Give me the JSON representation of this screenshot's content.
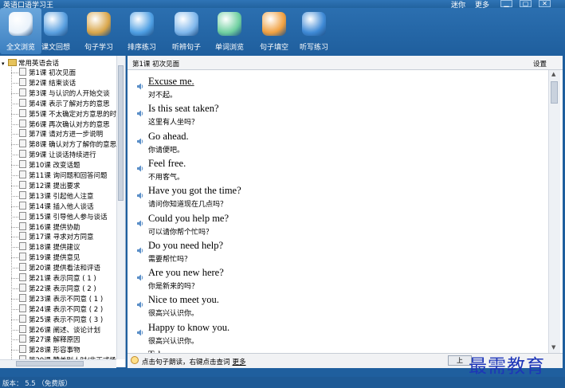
{
  "window": {
    "title": "英语口语学习王",
    "links": [
      "迷你",
      "更多"
    ],
    "controls": {
      "minimize": "▁",
      "maximize": "▢",
      "close": "✕"
    }
  },
  "toolbar": {
    "items": [
      {
        "label": "全文浏览",
        "icon": "home-icon",
        "color": "#e9f2fb",
        "active": true
      },
      {
        "label": "课文回想",
        "icon": "shield-icon",
        "color": "#5aa0e0"
      },
      {
        "label": "句子学习",
        "icon": "magnifier-icon",
        "color": "#d9a64a"
      },
      {
        "label": "排序练习",
        "icon": "gauge-icon",
        "color": "#4f9fe3"
      },
      {
        "label": "听辨句子",
        "icon": "orb-icon",
        "color": "#7fb7ec"
      },
      {
        "label": "单词浏览",
        "icon": "recycle-monitor-icon",
        "color": "#6fd0a0"
      },
      {
        "label": "句子填空",
        "icon": "disc-icon",
        "color": "#f0a040"
      },
      {
        "label": "听写练习",
        "icon": "globe-icon",
        "color": "#3f8ad6"
      }
    ]
  },
  "sidebar": {
    "root": "常用英语会话",
    "lessons": [
      "第1课 初次见面",
      "第2课 结束谈话",
      "第3课 与认识的人开始交谈",
      "第4课 表示了解对方的意思",
      "第5课 不太确定对方意思的时",
      "第6课 再次确认对方的意思",
      "第7课 请对方进一步说明",
      "第8课 确认对方了解你的意思",
      "第9课 让谈话持续进行",
      "第10课 改变话题",
      "第11课 询问题和回答问题",
      "第12课 提出要求",
      "第13课 引起他人注意",
      "第14课 插入他人谈话",
      "第15课 引导他人参与谈话",
      "第16课 提供协助",
      "第17课 寻求对方同意",
      "第18课 提供建议",
      "第19课 提供意见",
      "第20课 提供看法和评语",
      "第21课 表示同意 ( 1 )",
      "第22课 表示同意 ( 2 )",
      "第23课 表示不同意 ( 1 )",
      "第24课 表示不同意 ( 2 )",
      "第25课 表示不同意 ( 3 )",
      "第26课 阐述、谈论计划",
      "第27课 解释原因",
      "第28课 形容事物",
      "第29课 赞美别人时/非正式场"
    ]
  },
  "main": {
    "lesson_title": "第1课 初次见面",
    "settings_label": "设置",
    "sentences": [
      {
        "en": "Excuse me.",
        "cn": "对不起。"
      },
      {
        "en": "Is this seat taken?",
        "cn": "这里有人坐吗？"
      },
      {
        "en": "Go ahead.",
        "cn": "你请便吧。"
      },
      {
        "en": "Feel free.",
        "cn": "不用客气。"
      },
      {
        "en": "Have you got the time?",
        "cn": "请问你知道现在几点吗？"
      },
      {
        "en": "Could you help me?",
        "cn": "可以请你帮个忙吗？"
      },
      {
        "en": "Do you need help?",
        "cn": "需要帮忙吗？"
      },
      {
        "en": "Are you new here?",
        "cn": "你是新来的吗？"
      },
      {
        "en": "Nice to meet you.",
        "cn": "很高兴认识你。"
      },
      {
        "en": "Happy to know you.",
        "cn": "很高兴认识你。"
      },
      {
        "en": "Take care.",
        "cn": ""
      }
    ],
    "hint": "点击句子朗读，右键点击查词",
    "more_label": "更多",
    "prev_label": "上"
  },
  "status": {
    "version": "版本： 5.5 （免费版）"
  },
  "watermark": "最需教育"
}
